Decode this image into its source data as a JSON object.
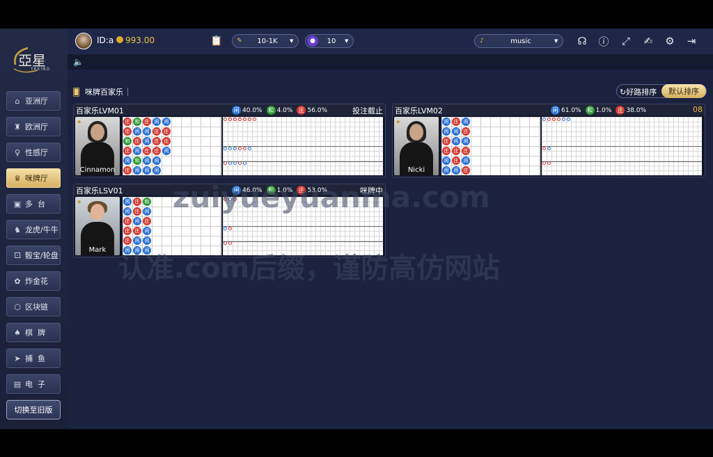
{
  "user": {
    "id_label": "ID:a",
    "balance": "993.00"
  },
  "topbar": {
    "limit_select": "10-1K",
    "chip_select": "10",
    "music_select": "music"
  },
  "sidebar": {
    "brand_cn": "亞星",
    "brand_en": "YAXING",
    "items": [
      {
        "label": "亚洲厅",
        "icon": "home-icon"
      },
      {
        "label": "欧洲厅",
        "icon": "tower-icon"
      },
      {
        "label": "性感厅",
        "icon": "dancer-icon"
      },
      {
        "label": "咪牌厅",
        "icon": "crown-icon",
        "active": true
      },
      {
        "label": "多  台",
        "icon": "multi-table-icon"
      },
      {
        "label": "龙虎/牛牛",
        "icon": "dragon-icon"
      },
      {
        "label": "骰宝/轮盘",
        "icon": "dice-icon"
      },
      {
        "label": "炸金花",
        "icon": "flower-icon"
      },
      {
        "label": "区块链",
        "icon": "blockchain-icon"
      },
      {
        "label": "棋  牌",
        "icon": "cards-icon"
      },
      {
        "label": "捕  鱼",
        "icon": "fish-icon"
      },
      {
        "label": "电  子",
        "icon": "slot-icon"
      }
    ],
    "switch_label": "切换至旧版"
  },
  "section": {
    "title": "咪牌百家乐",
    "sort_good": "好路排序",
    "sort_default": "默认排序"
  },
  "tables": [
    {
      "name": "百家乐LVM01",
      "player_label": "闲",
      "player_pct": "40.0%",
      "tie_label": "和",
      "tie_pct": "4.0%",
      "banker_label": "庄",
      "banker_pct": "56.0%",
      "status": "投注截止",
      "dealer": "Cinnamon"
    },
    {
      "name": "百家乐LVM02",
      "player_label": "闲",
      "player_pct": "61.0%",
      "tie_label": "和",
      "tie_pct": "1.0%",
      "banker_label": "庄",
      "banker_pct": "38.0%",
      "status": "08",
      "dealer": "Nicki"
    },
    {
      "name": "百家乐LSV01",
      "player_label": "闲",
      "player_pct": "46.0%",
      "tie_label": "和",
      "tie_pct": "1.0%",
      "banker_label": "庄",
      "banker_pct": "53.0%",
      "status": "咪牌中",
      "dealer": "Mark"
    }
  ],
  "watermarks": {
    "line1": "zuiyueyuanma.com",
    "line2": "认准.com后缀，谨防高仿网站"
  },
  "colors": {
    "player": "#2a74d6",
    "tie": "#2f9a33",
    "banker": "#d23a32",
    "gold": "#f0c14a"
  }
}
